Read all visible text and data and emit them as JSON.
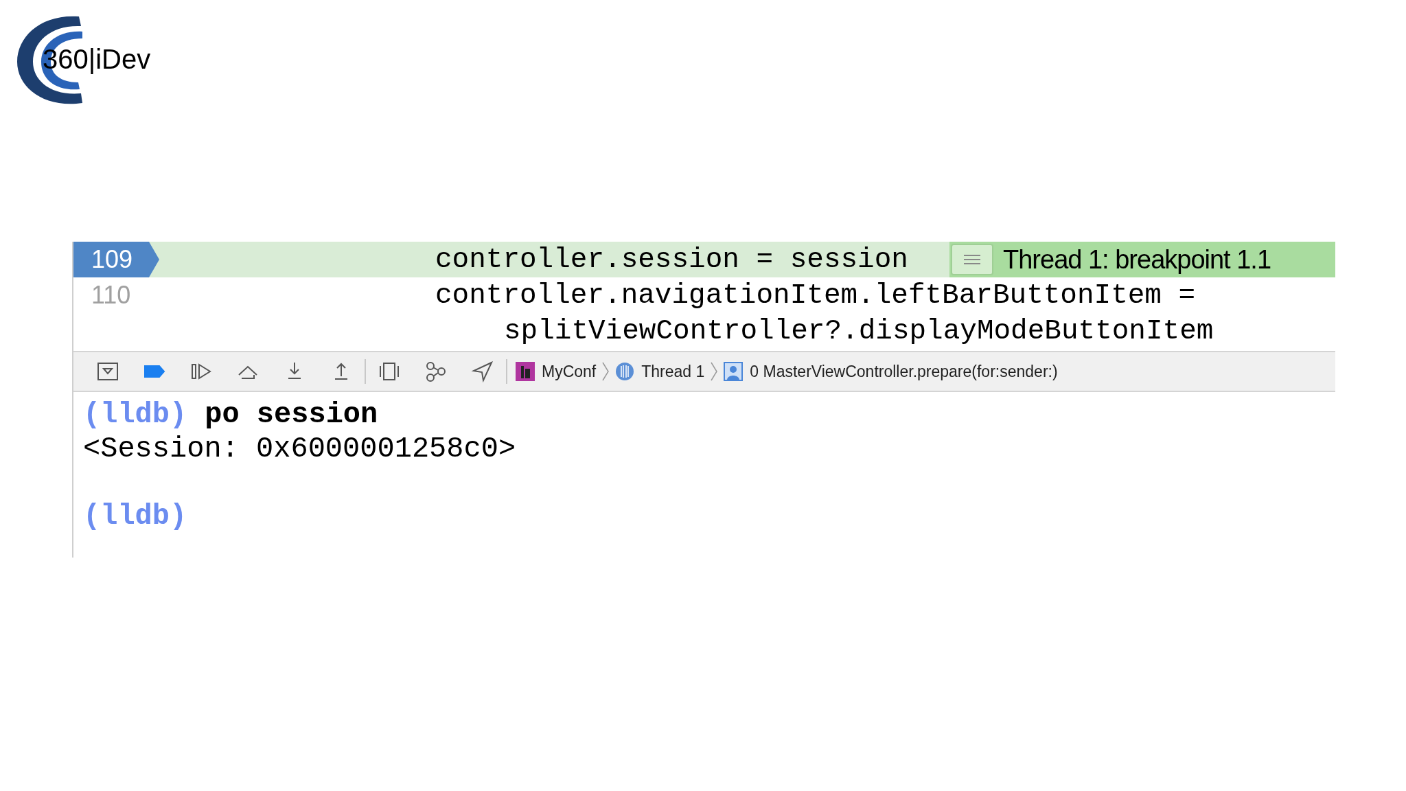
{
  "logo": {
    "text": "360|iDev"
  },
  "editor": {
    "lines": [
      {
        "number": "109",
        "code": [
          "controller.session = session"
        ],
        "current": true,
        "annotation": "Thread 1: breakpoint 1.1"
      },
      {
        "number": "110",
        "code": [
          "controller.navigationItem.leftBarButtonItem =",
          "splitViewController?.displayModeButtonItem"
        ],
        "current": false
      }
    ]
  },
  "debug_bar": {
    "breakpoints_active": true,
    "breadcrumbs": [
      {
        "kind": "app",
        "label": "MyConf"
      },
      {
        "kind": "thread",
        "label": "Thread 1"
      },
      {
        "kind": "frame",
        "label": "0 MasterViewController.prepare(for:sender:)"
      }
    ]
  },
  "console": {
    "lines": [
      {
        "kind": "command",
        "prompt": "(lldb)",
        "text": "po session"
      },
      {
        "kind": "output",
        "text": "<Session: 0x6000001258c0>"
      },
      {
        "kind": "prompt",
        "prompt": "(lldb)"
      }
    ]
  }
}
